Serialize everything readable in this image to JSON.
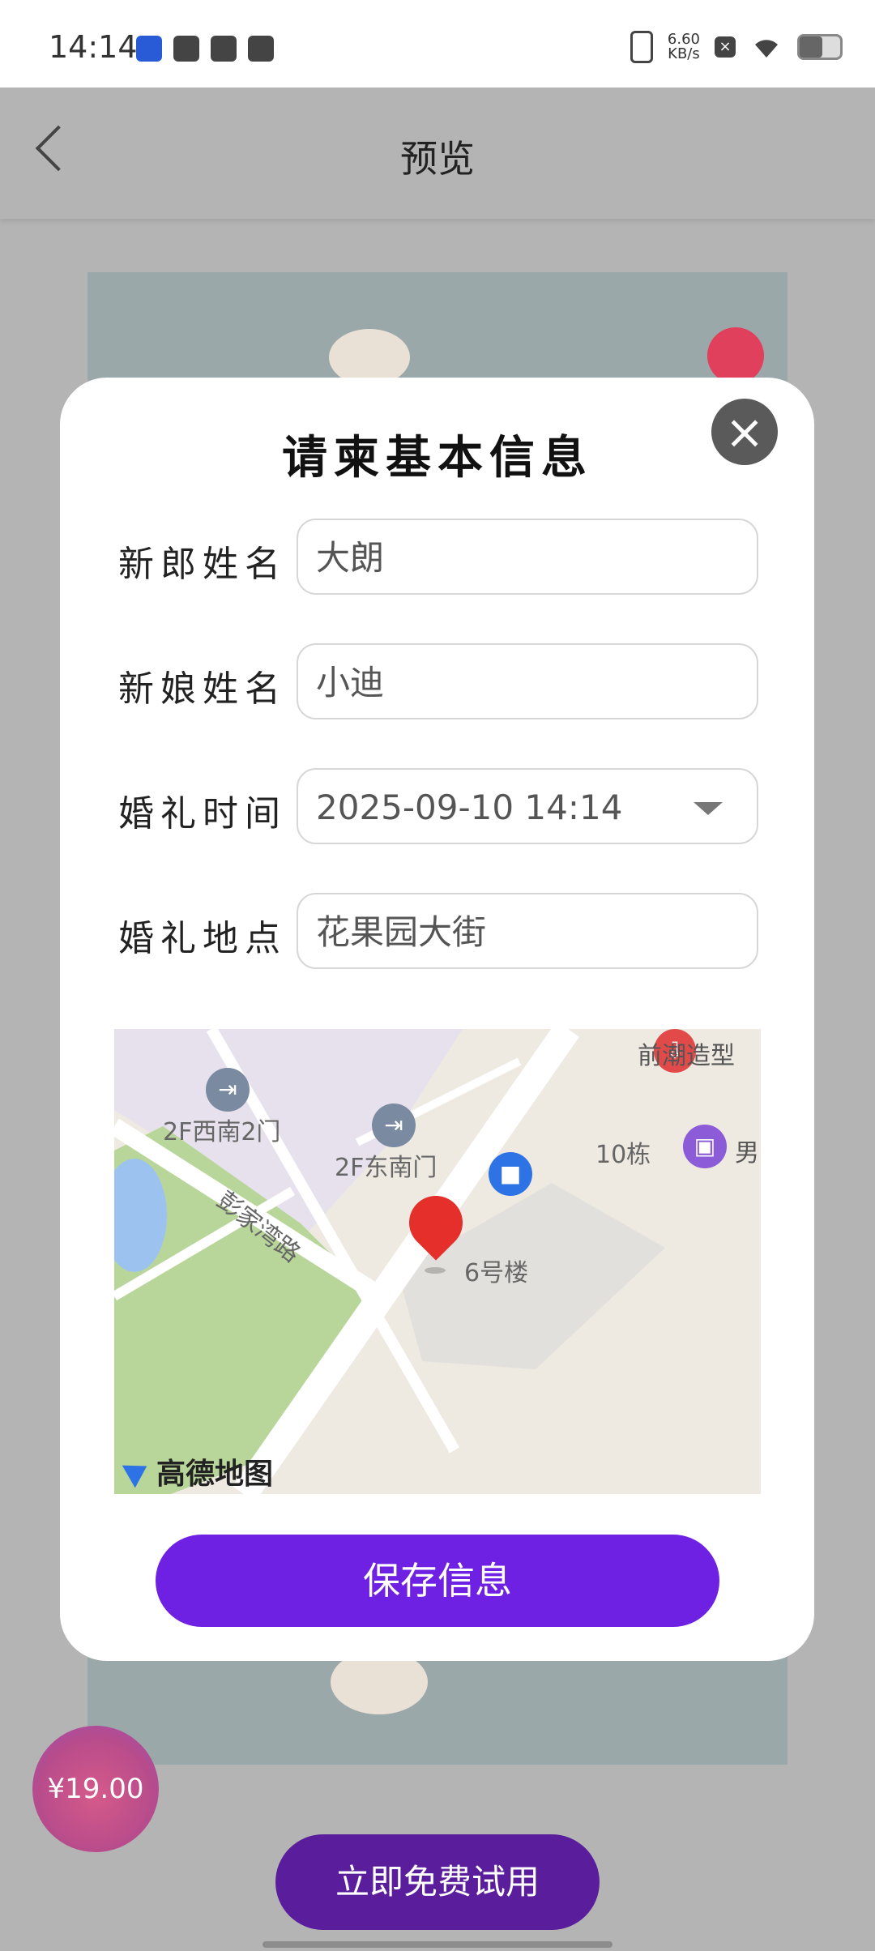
{
  "status_bar": {
    "time": "14:14",
    "net_speed_top": "6.60",
    "net_speed_bottom": "KB/s"
  },
  "nav": {
    "title": "预览",
    "back_icon": "chevron-left-icon"
  },
  "modal": {
    "title": "请柬基本信息",
    "close_icon": "close-icon",
    "fields": [
      {
        "label": "新郎姓名",
        "value": "大朗"
      },
      {
        "label": "新娘姓名",
        "value": "小迪"
      },
      {
        "label": "婚礼时间",
        "value": "2025-09-10 14:14"
      },
      {
        "label": "婚礼地点",
        "value": "花果园大街"
      }
    ],
    "map": {
      "labels": [
        "前潮造型",
        "2F西南2门",
        "2F东南门",
        "10栋",
        "男",
        "彭家湾路",
        "6号楼"
      ],
      "logo_text": "高德地图"
    },
    "save_button": "保存信息"
  },
  "price": "¥19.00",
  "trial_button": "立即免费试用",
  "colors": {
    "accent": "#6f21e3",
    "trial": "#5a1d9c",
    "pin": "#e52f2a"
  }
}
